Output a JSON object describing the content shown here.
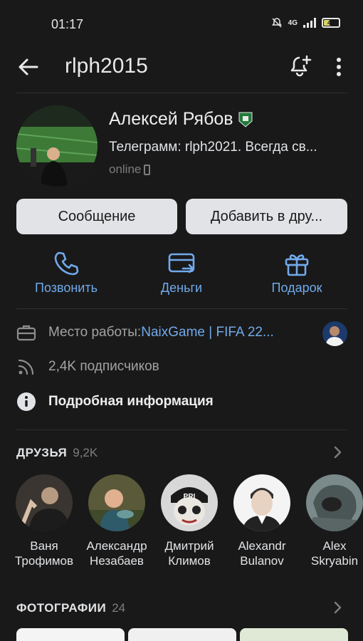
{
  "status_bar": {
    "time": "01:17",
    "signal": "4G",
    "battery": "41"
  },
  "header": {
    "title": "rlph2015"
  },
  "profile": {
    "name": "Алексей Рябов",
    "status_text": "Телеграмм: rlph2021. Всегда св...",
    "online": "online"
  },
  "buttons": {
    "message": "Сообщение",
    "add_friend": "Добавить в дру..."
  },
  "actions": [
    {
      "label": "Позвонить",
      "icon": "phone-icon"
    },
    {
      "label": "Деньги",
      "icon": "money-card-icon"
    },
    {
      "label": "Подарок",
      "icon": "gift-icon"
    }
  ],
  "info": {
    "work_label": "Место работы: ",
    "work_value": "NaixGame | FIFA 22...",
    "followers": "2,4K подписчиков",
    "details": "Подробная информация"
  },
  "friends_section": {
    "title": "ДРУЗЬЯ",
    "count": "9,2K"
  },
  "friends": [
    {
      "first": "Ваня",
      "last": "Трофимов"
    },
    {
      "first": "Александр",
      "last": "Незабаев"
    },
    {
      "first": "Дмитрий",
      "last": "Климов"
    },
    {
      "first": "Alexandr",
      "last": "Bulanov"
    },
    {
      "first": "Alex",
      "last": "Skryabin"
    }
  ],
  "photos_section": {
    "title": "ФОТОГРАФИИ",
    "count": "24"
  },
  "colors": {
    "background": "#191919",
    "accent": "#71aaeb",
    "button": "#e1e3e6"
  }
}
